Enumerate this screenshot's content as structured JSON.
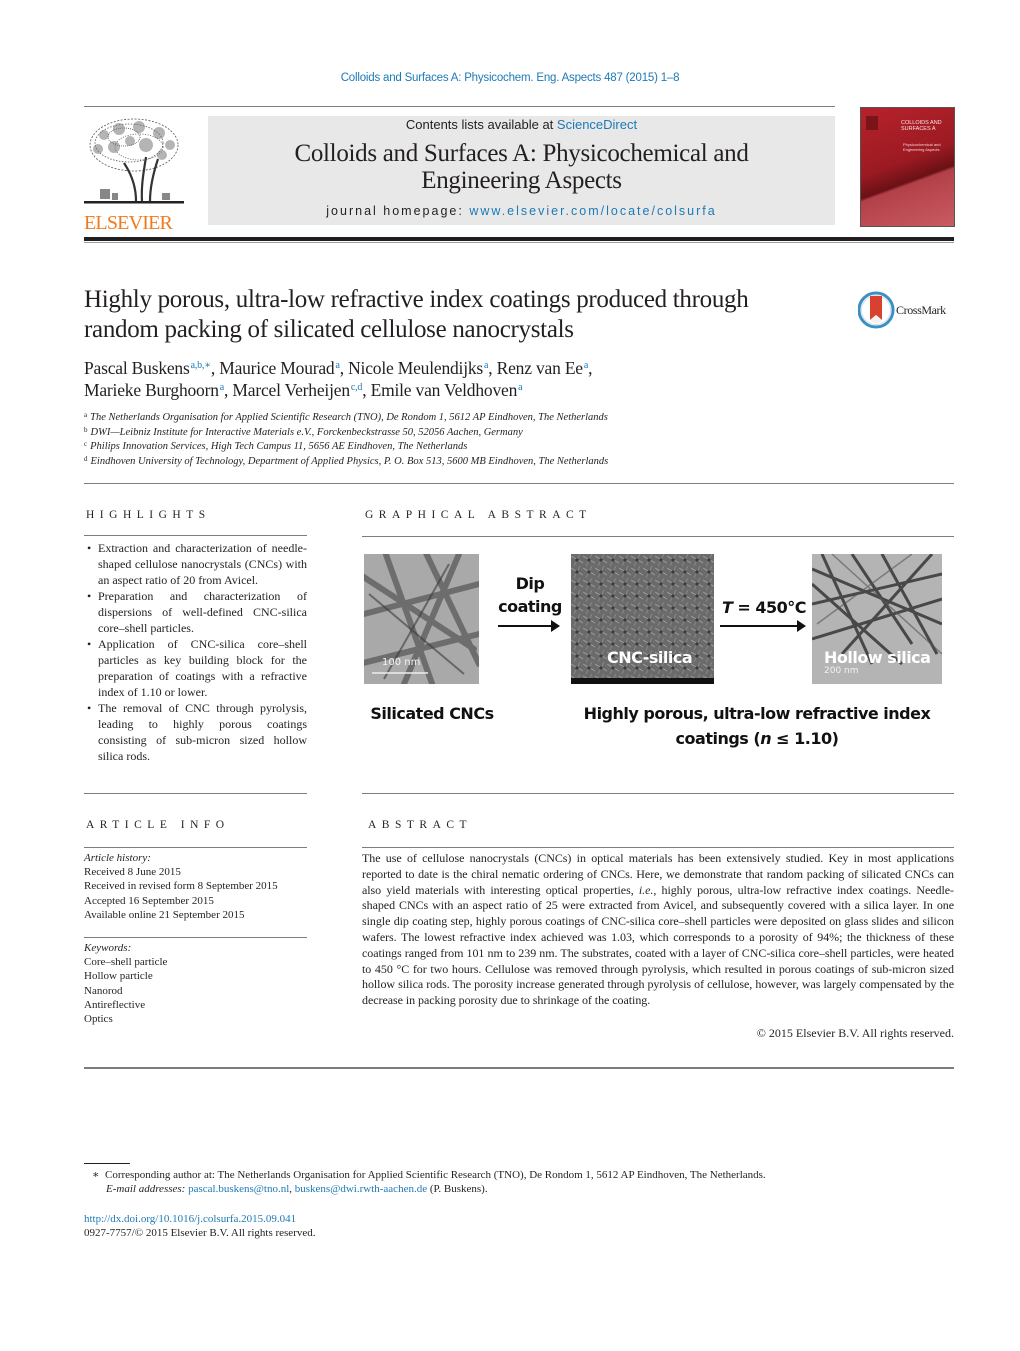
{
  "running_head": "Colloids and Surfaces A: Physicochem. Eng. Aspects 487 (2015) 1–8",
  "masthead": {
    "publisher_logo_text": "ELSEVIER",
    "contents_prefix": "Contents lists available at ",
    "contents_link": "ScienceDirect",
    "journal_title_line1": "Colloids and Surfaces A: Physicochemical and",
    "journal_title_line2": "Engineering Aspects",
    "homepage_prefix": "journal homepage: ",
    "homepage_link": "www.elsevier.com/locate/colsurfa",
    "cover_title": "COLLOIDS AND SURFACES A",
    "cover_subtitle": "Physicochemical and Engineering Aspects"
  },
  "colors": {
    "link": "#1d7ab5",
    "elsevier_orange": "#f07a1e",
    "masthead_bg": "#e8e8e8",
    "cover_red": "#b7222b",
    "crossmark_red": "#d9412f"
  },
  "article": {
    "title_line1": "Highly porous, ultra-low refractive index coatings produced through",
    "title_line2": "random packing of silicated cellulose nanocrystals",
    "crossmark_label": "CrossMark",
    "authors": [
      {
        "name": "Pascal Buskens",
        "sup": "a,b,∗",
        "sep": ", "
      },
      {
        "name": "Maurice Mourad",
        "sup": "a",
        "sep": ", "
      },
      {
        "name": "Nicole Meulendijks",
        "sup": "a",
        "sep": ", "
      },
      {
        "name": "Renz van Ee",
        "sup": "a",
        "sep": ","
      },
      {
        "name": "Marieke Burghoorn",
        "sup": "a",
        "sep": ", "
      },
      {
        "name": "Marcel Verheijen",
        "sup": "c,d",
        "sep": ", "
      },
      {
        "name": "Emile van Veldhoven",
        "sup": "a",
        "sep": ""
      }
    ],
    "affiliations": [
      {
        "key": "a",
        "text": "The Netherlands Organisation for Applied Scientific Research (TNO), De Rondom 1, 5612 AP Eindhoven, The Netherlands"
      },
      {
        "key": "b",
        "text": "DWI—Leibniz Institute for Interactive Materials e.V., Forckenbeckstrasse 50, 52056 Aachen, Germany"
      },
      {
        "key": "c",
        "text": "Philips Innovation Services, High Tech Campus 11, 5656 AE Eindhoven, The Netherlands"
      },
      {
        "key": "d",
        "text": "Eindhoven University of Technology, Department of Applied Physics, P. O. Box 513, 5600 MB Eindhoven, The Netherlands"
      }
    ]
  },
  "highlights": {
    "heading": "Highlights",
    "items": [
      "Extraction and characterization of needle-shaped cellulose nanocrystals (CNCs) with an aspect ratio of 20 from Avicel.",
      "Preparation and characterization of dispersions of well-defined CNC-silica core–shell particles.",
      "Application of CNC-silica core–shell particles as key building block for the preparation of coatings with a refractive index of 1.10 or lower.",
      "The removal of CNC through pyrolysis, leading to highly porous coatings consisting of sub-micron sized hollow silica rods."
    ]
  },
  "graphical_abstract": {
    "heading": "Graphical abstract",
    "image1_scale": "100  nm",
    "step1_line1": "Dip",
    "step1_line2": "coating",
    "image2_label": "CNC-silica",
    "step2_label_italic": "T",
    "step2_label_rest": " = 450°C",
    "image3_label": "Hollow silica",
    "image3_scale": "200  nm",
    "caption_left": "Silicated CNCs",
    "caption_right_line1": "Highly porous, ultra-low refractive index",
    "caption_right_line2_prefix": "coatings (",
    "caption_right_line2_italic": "n",
    "caption_right_line2_suffix": " ≤ 1.10)"
  },
  "article_info": {
    "heading": "Article info",
    "history_label": "Article history:",
    "history": [
      "Received 8 June 2015",
      "Received in revised form 8 September 2015",
      "Accepted 16 September 2015",
      "Available online 21 September 2015"
    ],
    "keywords_label": "Keywords:",
    "keywords": [
      "Core–shell particle",
      "Hollow particle",
      "Nanorod",
      "Antireflective",
      "Optics"
    ]
  },
  "abstract": {
    "heading": "Abstract",
    "text_part1": "The use of cellulose nanocrystals (CNCs) in optical materials has been extensively studied. Key in most applications reported to date is the chiral nematic ordering of CNCs. Here, we demonstrate that random packing of silicated CNCs can also yield materials with interesting optical properties, ",
    "text_italic": "i.e.",
    "text_part2": ", highly porous, ultra-low refractive index coatings. Needle-shaped CNCs with an aspect ratio of 25 were extracted from Avicel, and subsequently covered with a silica layer. In one single dip coating step, highly porous coatings of CNC-silica core–shell particles were deposited on glass slides and silicon wafers. The lowest refractive index achieved was 1.03, which corresponds to a porosity of 94%; the thickness of these coatings ranged from 101 nm to 239 nm. The substrates, coated with a layer of CNC-silica core–shell particles, were heated to 450 °C for two hours. Cellulose was removed through pyrolysis, which resulted in porous coatings of sub-micron sized hollow silica rods. The porosity increase generated through pyrolysis of cellulose, however, was largely compensated by the decrease in packing porosity due to shrinkage of the coating.",
    "copyright": "© 2015 Elsevier B.V. All rights reserved."
  },
  "footnotes": {
    "corresponding_mark": "∗",
    "corresponding": "Corresponding author at: The Netherlands Organisation for Applied Scientific Research (TNO), De Rondom 1, 5612 AP Eindhoven, The Netherlands.",
    "email_label": "E-mail addresses:",
    "email1": "pascal.buskens@tno.nl",
    "email_sep": ", ",
    "email2": "buskens@dwi.rwth-aachen.de",
    "email_suffix": " (P. Buskens).",
    "doi": "http://dx.doi.org/10.1016/j.colsurfa.2015.09.041",
    "issn": "0927-7757/© 2015 Elsevier B.V. All rights reserved."
  }
}
